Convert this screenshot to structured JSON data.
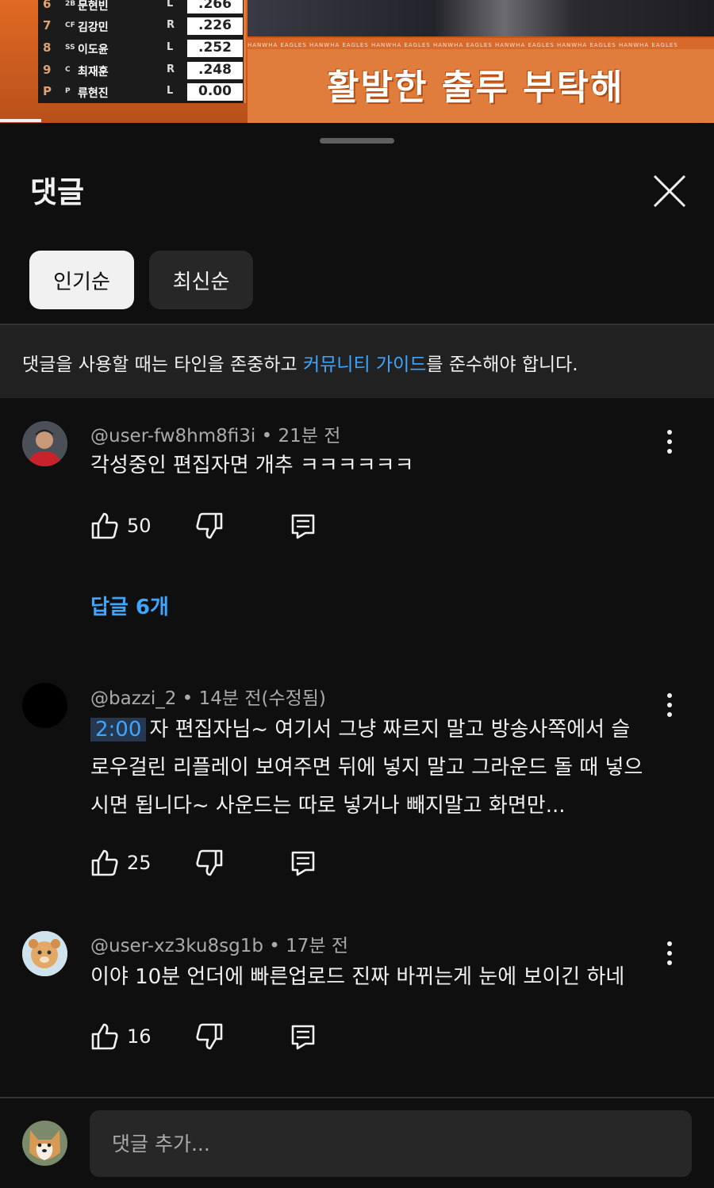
{
  "video": {
    "lineup": [
      {
        "order": "6",
        "pos": "2B",
        "name": "문현빈",
        "hand": "L",
        "avg": ".266"
      },
      {
        "order": "7",
        "pos": "CF",
        "name": "김강민",
        "hand": "R",
        "avg": ".226"
      },
      {
        "order": "8",
        "pos": "SS",
        "name": "이도윤",
        "hand": "L",
        "avg": ".252"
      },
      {
        "order": "9",
        "pos": "C",
        "name": "최재훈",
        "hand": "R",
        "avg": ".248"
      },
      {
        "order": "P",
        "pos": "P",
        "name": "류현진",
        "hand": "L",
        "avg": "0.00"
      }
    ],
    "strip_text": "HANWHA EAGLES    HANWHA EAGLES    HANWHA EAGLES    HANWHA EAGLES    HANWHA EAGLES    HANWHA EAGLES    HANWHA EAGLES",
    "banner_text": "활발한 출루 부탁해",
    "progress_fraction": 0.058
  },
  "sheet": {
    "title": "댓글",
    "close_icon": "close-icon",
    "sort_chips": [
      {
        "label": "인기순",
        "active": true
      },
      {
        "label": "최신순",
        "active": false
      }
    ],
    "guide": {
      "before": "댓글을 사용할 때는 타인을 존중하고 ",
      "link": "커뮤니티 가이드",
      "after": "를 준수해야 합니다."
    }
  },
  "comments": [
    {
      "author": "@user-fw8hm8fi3i",
      "time": "21분 전",
      "text": "각성중인 편집자면 개추 ㅋㅋㅋㅋㅋㅋ",
      "likes": "50",
      "replies_label": "답글 6개"
    },
    {
      "author": "@bazzi_2",
      "time": "14분 전(수정됨)",
      "timestamp": "2:00",
      "text": "자 편집자님~ 여기서 그냥 짜르지 말고 방송사쪽에서 슬로우걸린 리플레이 보여주면 뒤에 넣지 말고 그라운드 돌 때 넣으시면 됩니다~ 사운드는 따로 넣거나 빼지말고 화면만...",
      "likes": "25"
    },
    {
      "author": "@user-xz3ku8sg1b",
      "time": "17분 전",
      "text": "이야 10분 언더에 빠른업로드 진짜 바뀌는게 눈에 보이긴 하네",
      "likes": "16"
    }
  ],
  "composer": {
    "placeholder": "댓글 추가..."
  },
  "colors": {
    "background": "#0f0f0f",
    "link": "#3ea6ff",
    "chip_active": "#f1f1f1",
    "chip_inactive": "#272727",
    "meta_text": "#aaaaaa"
  }
}
